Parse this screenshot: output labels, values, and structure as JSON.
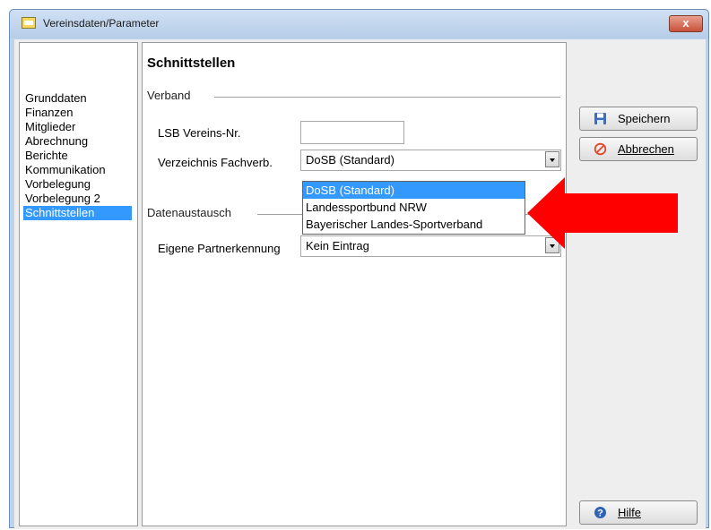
{
  "window": {
    "title": "Vereinsdaten/Parameter",
    "close_label": "x"
  },
  "nav": {
    "items": [
      {
        "label": "Grunddaten",
        "selected": false
      },
      {
        "label": "Finanzen",
        "selected": false
      },
      {
        "label": "Mitglieder",
        "selected": false
      },
      {
        "label": "Abrechnung",
        "selected": false
      },
      {
        "label": "Berichte",
        "selected": false
      },
      {
        "label": "Kommunikation",
        "selected": false
      },
      {
        "label": "Vorbelegung",
        "selected": false
      },
      {
        "label": "Vorbelegung 2",
        "selected": false
      },
      {
        "label": "Schnittstellen",
        "selected": true
      }
    ]
  },
  "content": {
    "title": "Schnittstellen",
    "verband": {
      "group_label": "Verband",
      "lsb_label": "LSB Vereins-Nr.",
      "lsb_value": "",
      "fachverb_label": "Verzeichnis Fachverb.",
      "fachverb_value": "DoSB (Standard)",
      "fachverb_options": [
        "DoSB (Standard)",
        "Landessportbund NRW",
        "Bayerischer Landes-Sportverband"
      ]
    },
    "datenaustausch": {
      "group_label": "Datenaustausch",
      "partner_label": "Eigene Partnerkennung",
      "partner_value": "Kein Eintrag"
    }
  },
  "buttons": {
    "save": "Speichern",
    "cancel": "Abbrechen",
    "help": "Hilfe"
  },
  "icons": {
    "save": "floppy-disk-icon",
    "cancel": "cancel-circle-icon",
    "help": "help-question-icon",
    "annotation": "red-arrow-pointer"
  },
  "colors": {
    "selection": "#3399ff",
    "arrow": "#ff0000"
  }
}
